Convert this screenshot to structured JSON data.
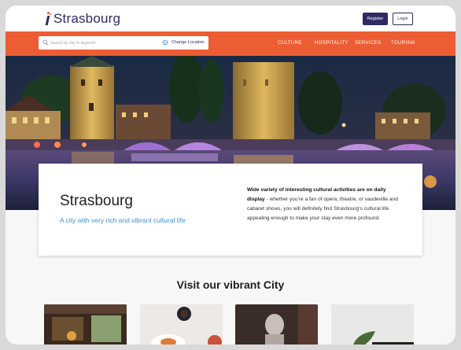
{
  "header": {
    "logo_text": "Strasbourg",
    "register_label": "Register",
    "login_label": "Login"
  },
  "nav": {
    "search_placeholder": "Search by city or keyword",
    "change_location_label": "Change Location",
    "items": [
      "CULTURE",
      "HOSPITALITY",
      "SERVICES",
      "TOURISM"
    ]
  },
  "card": {
    "title": "Strasbourg",
    "subtitle": "A city with very rich and vibrant cultural life",
    "description_bold": "Wide variety of interesting cultural activities are on daily display",
    "description_rest": " - whether you're a fan of opera, theatre, or vaudeville and cabaret shows, you will definitely find Strasbourg's cultural life appealing enough to make your stay even more profound."
  },
  "section": {
    "title": "Visit our vibrant City"
  },
  "colors": {
    "brand": "#2f2a63",
    "accent": "#ec5d34",
    "link": "#3a8fd4"
  },
  "icons": [
    "search-icon",
    "location-icon"
  ]
}
